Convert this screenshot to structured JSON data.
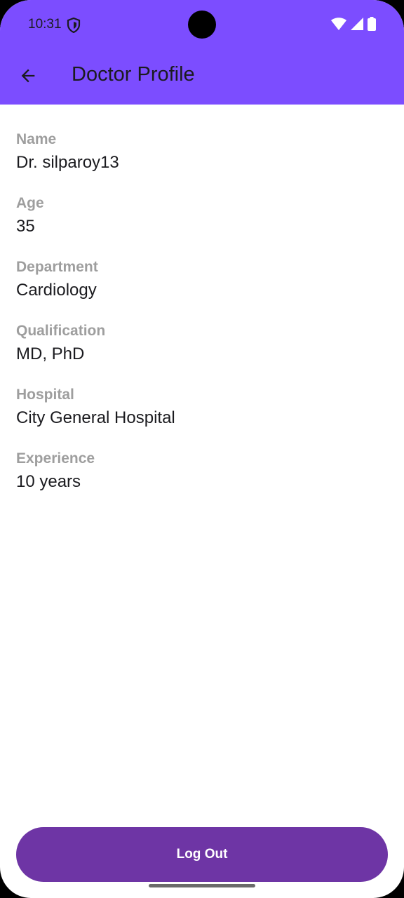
{
  "status_bar": {
    "time": "10:31",
    "icons": [
      "shield-icon",
      "wifi-icon",
      "signal-icon",
      "battery-icon"
    ]
  },
  "app_bar": {
    "title": "Doctor Profile",
    "back_icon": "arrow-back-icon",
    "background_color": "#7c4dff"
  },
  "profile": {
    "fields": [
      {
        "label": "Name",
        "value": "Dr. silparoy13"
      },
      {
        "label": "Age",
        "value": "35"
      },
      {
        "label": "Department",
        "value": "Cardiology"
      },
      {
        "label": "Qualification",
        "value": "MD, PhD"
      },
      {
        "label": "Hospital",
        "value": "City General Hospital"
      },
      {
        "label": "Experience",
        "value": "10 years"
      }
    ]
  },
  "actions": {
    "logout_label": "Log Out",
    "logout_color": "#6e35a5"
  }
}
